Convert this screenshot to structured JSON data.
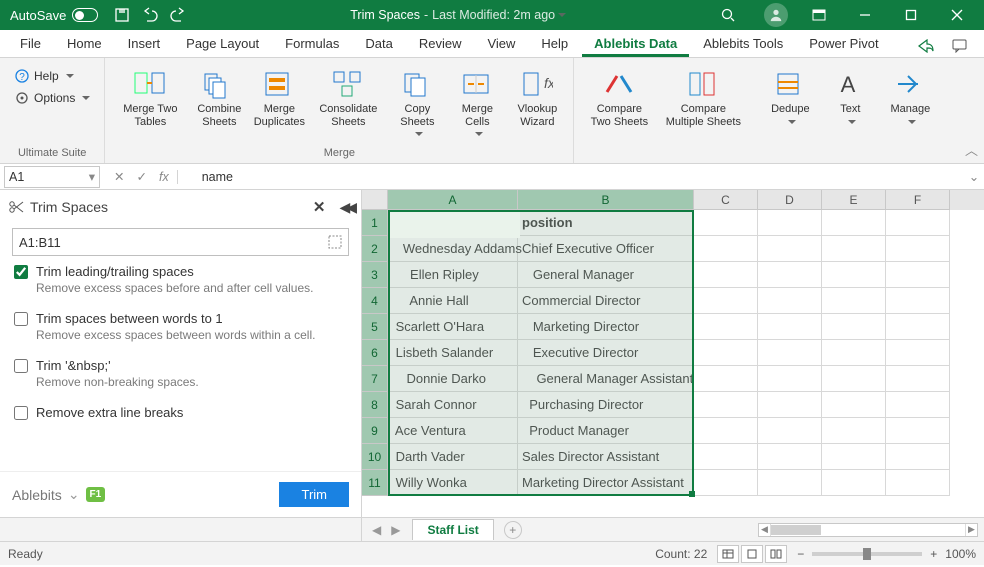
{
  "titlebar": {
    "autosave_label": "AutoSave",
    "autosave_state": "On",
    "doc_title": "Trim Spaces",
    "modified": "Last Modified: 2m ago"
  },
  "tabs": [
    "File",
    "Home",
    "Insert",
    "Page Layout",
    "Formulas",
    "Data",
    "Review",
    "View",
    "Help",
    "Ablebits Data",
    "Ablebits Tools",
    "Power Pivot"
  ],
  "active_tab": "Ablebits Data",
  "ribbon": {
    "suite_group": "Ultimate Suite",
    "help_label": "Help",
    "options_label": "Options",
    "merge_group": "Merge",
    "buttons": {
      "merge_two_tables": "Merge\nTwo Tables",
      "combine_sheets": "Combine\nSheets",
      "merge_duplicates": "Merge\nDuplicates",
      "consolidate_sheets": "Consolidate\nSheets",
      "copy_sheets": "Copy\nSheets",
      "merge_cells": "Merge\nCells",
      "vlookup_wizard": "Vlookup\nWizard",
      "compare_two_sheets": "Compare\nTwo Sheets",
      "compare_multiple_sheets": "Compare\nMultiple Sheets",
      "dedupe": "Dedupe",
      "text": "Text",
      "manage": "Manage"
    }
  },
  "formula_bar": {
    "name_box": "A1",
    "formula": "name"
  },
  "task_pane": {
    "title": "Trim Spaces",
    "range": "A1:B11",
    "opt1_label": "Trim leading/trailing spaces",
    "opt1_sub": "Remove excess spaces before and after cell values.",
    "opt2_label": "Trim spaces between words to 1",
    "opt2_sub": "Remove excess spaces between words within a cell.",
    "opt3_label": "Trim '&nbsp;'",
    "opt3_sub": "Remove non-breaking spaces.",
    "opt4_label": "Remove extra line breaks",
    "brand": "Ablebits",
    "f1": "F1",
    "trim_btn": "Trim"
  },
  "grid": {
    "columns": [
      "A",
      "B",
      "C",
      "D",
      "E",
      "F"
    ],
    "headers": {
      "A": "name",
      "B": "position"
    },
    "rows": [
      {
        "A": "   Wednesday Addams",
        "B": "Chief Executive Officer"
      },
      {
        "A": "     Ellen Ripley",
        "B": "   General Manager"
      },
      {
        "A": "     Annie Hall",
        "B": "Commercial Director"
      },
      {
        "A": " Scarlett O'Hara",
        "B": "   Marketing Director"
      },
      {
        "A": " Lisbeth Salander",
        "B": "   Executive Director"
      },
      {
        "A": "    Donnie Darko",
        "B": "    General Manager Assistant"
      },
      {
        "A": " Sarah Connor",
        "B": "  Purchasing Director"
      },
      {
        "A": " Ace Ventura",
        "B": "  Product Manager"
      },
      {
        "A": " Darth Vader",
        "B": "Sales Director Assistant"
      },
      {
        "A": " Willy Wonka",
        "B": "Marketing Director Assistant"
      }
    ]
  },
  "sheet_tabs": {
    "active": "Staff List"
  },
  "status": {
    "ready": "Ready",
    "count": "Count: 22",
    "zoom": "100%"
  }
}
